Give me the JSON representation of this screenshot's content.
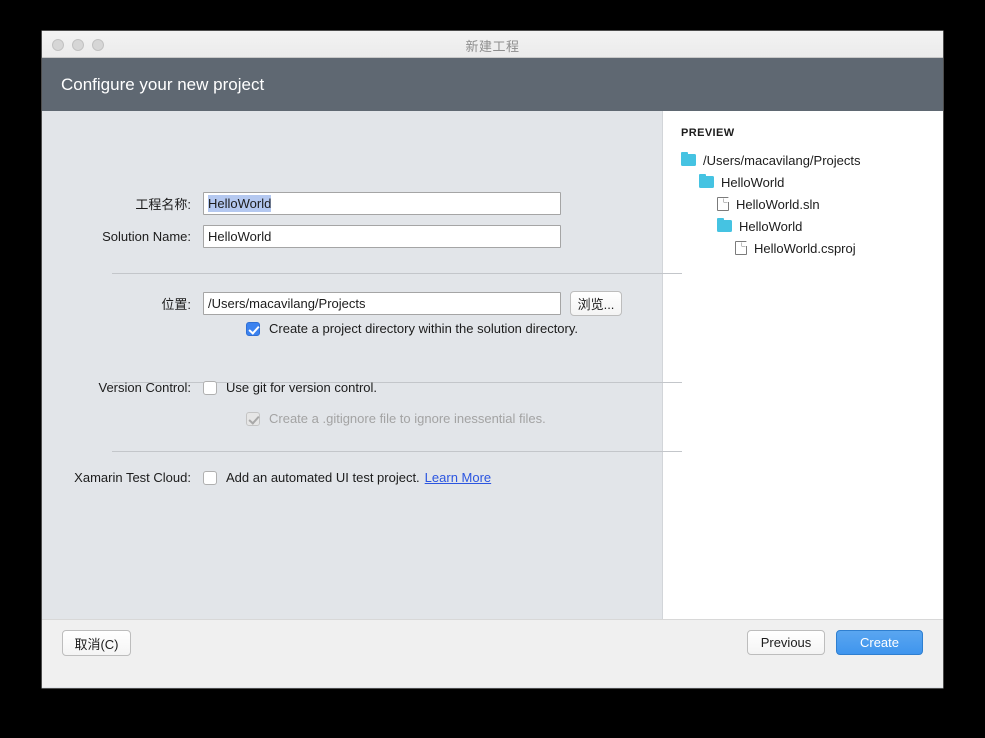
{
  "window": {
    "title": "新建工程",
    "traffic_lights": [
      "close",
      "minimize",
      "zoom"
    ]
  },
  "header": {
    "title": "Configure your new project"
  },
  "form": {
    "project_name": {
      "label": "工程名称:",
      "value": "HelloWorld",
      "selected": true
    },
    "solution_name": {
      "label": "Solution Name:",
      "value": "HelloWorld"
    },
    "location": {
      "label": "位置:",
      "value": "/Users/macavilang/Projects",
      "browse_label": "浏览..."
    },
    "project_dir_checkbox": {
      "label": "Create a project directory within the solution directory.",
      "checked": true,
      "enabled": true
    },
    "version_control": {
      "label": "Version Control:",
      "use_git": {
        "label": "Use git for version control.",
        "checked": false,
        "enabled": true
      },
      "gitignore": {
        "label": "Create a .gitignore file to ignore inessential files.",
        "checked": true,
        "enabled": false
      }
    },
    "xamarin_test_cloud": {
      "label": "Xamarin Test Cloud:",
      "checkbox_label": "Add an automated UI test project.",
      "checked": false,
      "link_label": "Learn More"
    }
  },
  "preview": {
    "title": "PREVIEW",
    "tree": [
      {
        "name": "/Users/macavilang/Projects",
        "type": "folder",
        "depth": 0
      },
      {
        "name": "HelloWorld",
        "type": "folder",
        "depth": 1
      },
      {
        "name": "HelloWorld.sln",
        "type": "file",
        "depth": 2
      },
      {
        "name": "HelloWorld",
        "type": "folder",
        "depth": 2
      },
      {
        "name": "HelloWorld.csproj",
        "type": "file",
        "depth": 3
      }
    ]
  },
  "footer": {
    "cancel_label": "取消(C)",
    "previous_label": "Previous",
    "create_label": "Create"
  },
  "colors": {
    "header_bg": "#5f6872",
    "accent_blue": "#3b82ef",
    "create_btn": "#4a9cef",
    "folder_icon": "#45c3e2",
    "selection": "#b4c8f0",
    "link": "#2b55e0",
    "pane_bg": "#e2e5e9"
  }
}
